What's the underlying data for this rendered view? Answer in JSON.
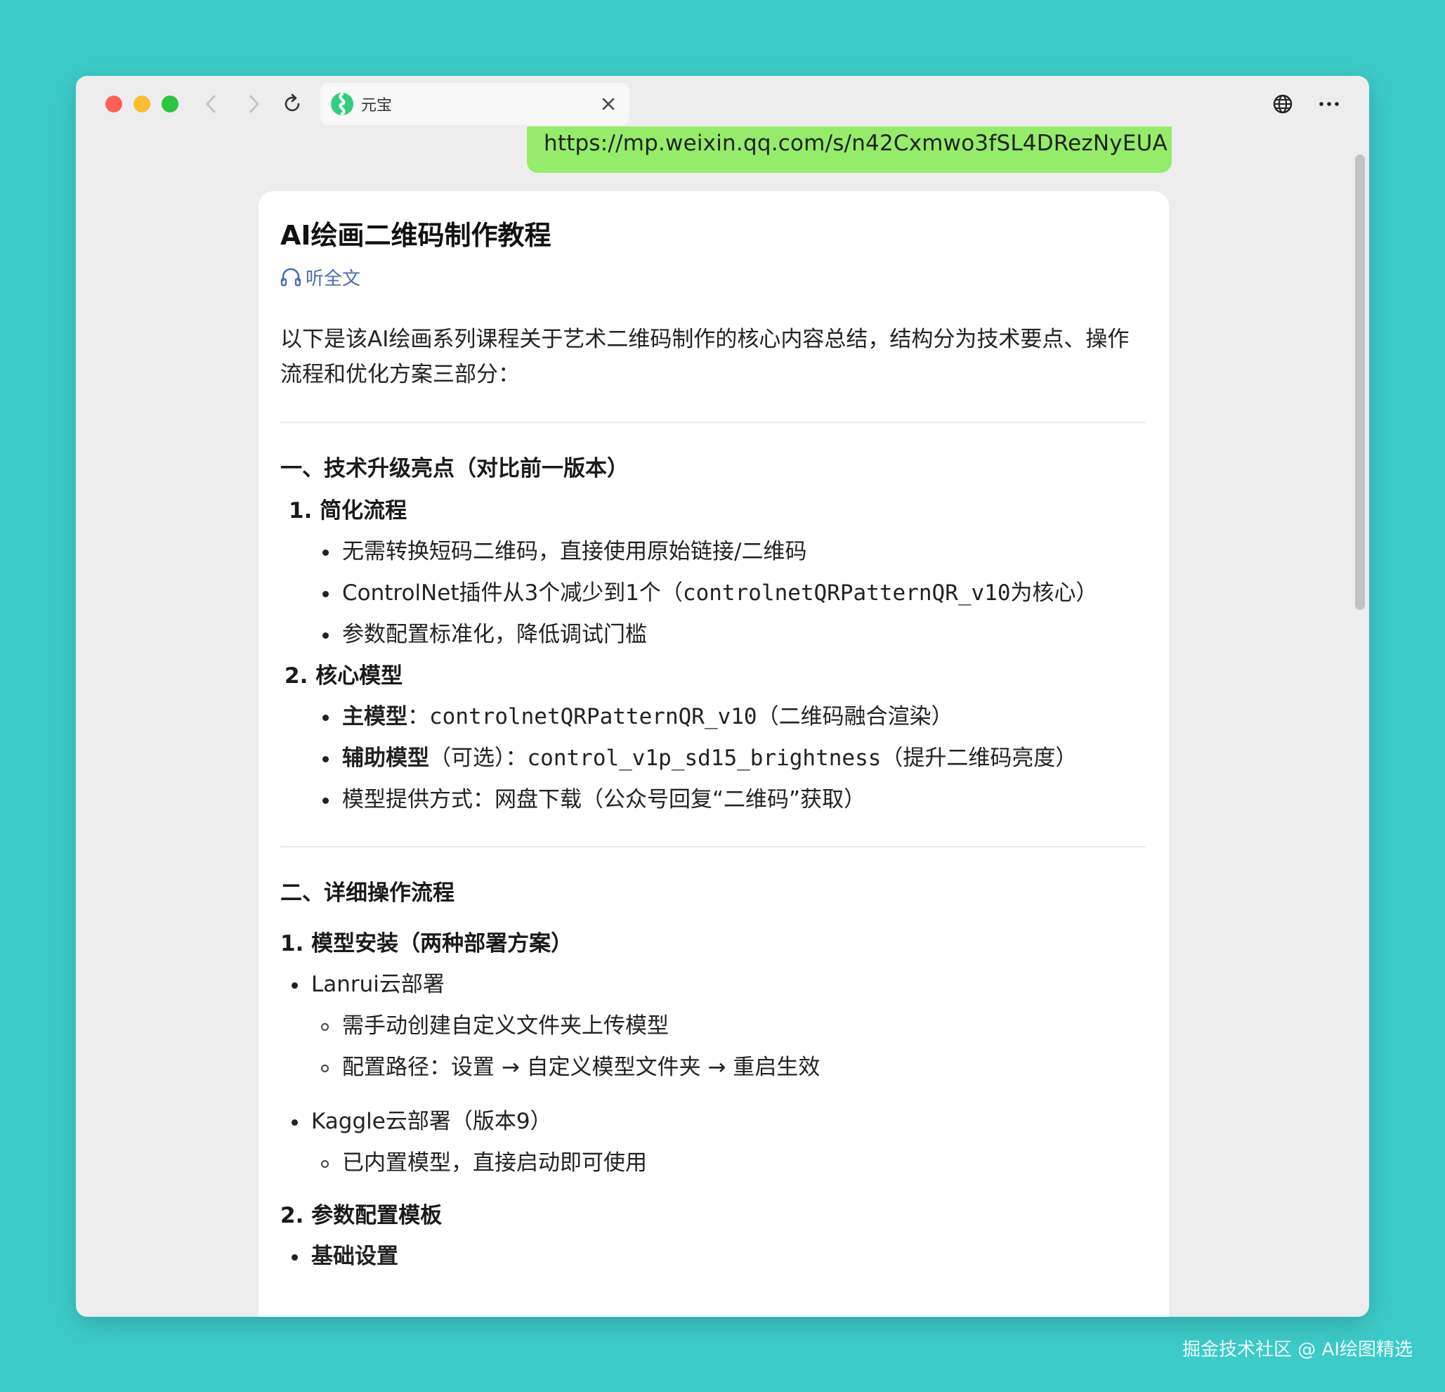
{
  "browser": {
    "tab_title": "元宝",
    "url_message": "https://mp.weixin.qq.com/s/n42Cxmwo3fSL4DRezNyEUA",
    "colors": {
      "close": "#fe5f57",
      "minimize": "#febc2e",
      "maximize": "#28c840",
      "bubble": "#95ec69"
    }
  },
  "article": {
    "title": "AI绘画二维码制作教程",
    "listen_label": "听全文",
    "intro": "以下是该AI绘画系列课程关于艺术二维码制作的核心内容总结，结构分为技术要点、操作流程和优化方案三部分：",
    "section1": {
      "heading": "一、技术升级亮点（对比前一版本）",
      "sub1": {
        "heading": "1. 简化流程",
        "items": [
          "无需转换短码二维码，直接使用原始链接/二维码",
          "参数配置标准化，降低调试门槛"
        ],
        "item2_prefix": "ControlNet插件从3个减少到1个（",
        "item2_code": "controlnetQRPatternQR_v10",
        "item2_suffix": "为核心）"
      },
      "sub2": {
        "heading": "2. 核心模型",
        "item1_bold": "主模型",
        "item1_sep": "：",
        "item1_code": "controlnetQRPatternQR_v10",
        "item1_suffix": "（二维码融合渲染）",
        "item2_bold": "辅助模型",
        "item2_mid": "（可选）：",
        "item2_code": "control_v1p_sd15_brightness",
        "item2_suffix": "（提升二维码亮度）",
        "item3": "模型提供方式：网盘下载（公众号回复“二维码”获取）"
      }
    },
    "section2": {
      "heading": "二、详细操作流程",
      "sub1": {
        "heading": "1. 模型安装（两种部署方案）",
        "lanrui": "Lanrui云部署",
        "lanrui_items": [
          "需手动创建自定义文件夹上传模型",
          "配置路径：设置 → 自定义模型文件夹 → 重启生效"
        ],
        "kaggle": "Kaggle云部署（版本9）",
        "kaggle_items": [
          "已内置模型，直接启动即可使用"
        ]
      },
      "sub2": {
        "heading": "2. 参数配置模板",
        "basic": "基础设置"
      }
    }
  },
  "watermark": "掘金技术社区 @ AI绘图精选"
}
